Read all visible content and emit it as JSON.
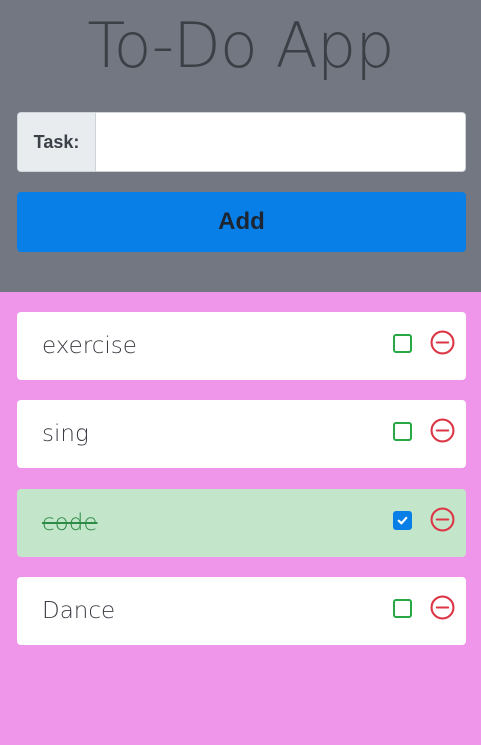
{
  "app": {
    "title": "To-Do App"
  },
  "form": {
    "task_label": "Task:",
    "task_value": "",
    "add_label": "Add"
  },
  "todos": [
    {
      "text": "exercise",
      "done": false
    },
    {
      "text": "sing",
      "done": false
    },
    {
      "text": "code",
      "done": true
    },
    {
      "text": "Dance",
      "done": false
    }
  ],
  "colors": {
    "header_bg": "#737782",
    "page_bg": "#ef96eb",
    "accent": "#087fe6",
    "done_bg": "#c3e6cb",
    "check_border": "#28a745",
    "remove": "#dc3545"
  },
  "icons": {
    "check": "check-icon",
    "remove": "minus-circle-icon"
  }
}
